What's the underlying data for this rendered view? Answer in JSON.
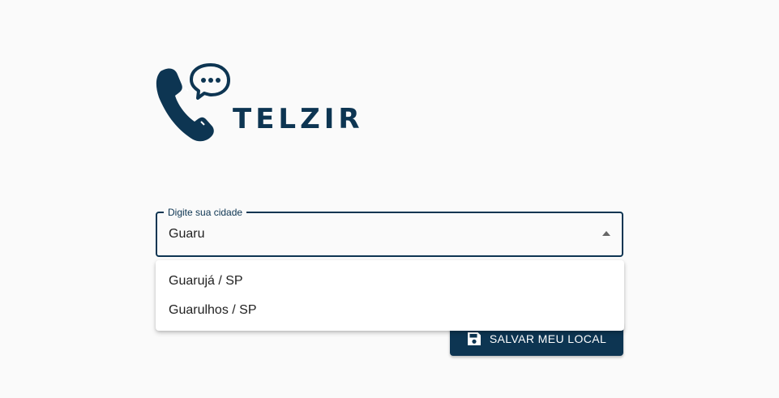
{
  "brand": {
    "name": "TELZIR",
    "logo_icon": "phone-chat-icon",
    "color": "#0d3552"
  },
  "city_field": {
    "label": "Digite sua cidade",
    "value": "Guaru",
    "arrow_icon": "arrow-up-icon"
  },
  "suggestions": [
    {
      "label": "Guarujá / SP"
    },
    {
      "label": "Guarulhos / SP"
    }
  ],
  "save_button": {
    "label": "SALVAR MEU LOCAL",
    "icon": "save-icon"
  }
}
